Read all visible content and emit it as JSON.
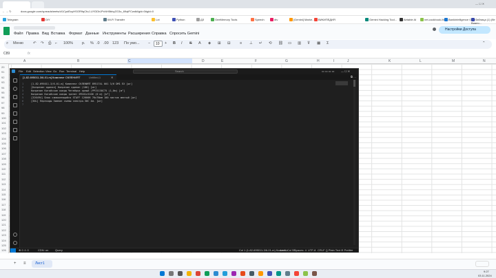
{
  "browser": {
    "url": "docs.google.com/spreadsheets/d/1CpdEuyHSGR9qCfuJ-UYDDhJPcNH5bbyZG3o_69qtFCwdkl/gid=0#gid=0",
    "bookmarks": [
      "Telegram",
      "",
      "",
      "DIY",
      "",
      "",
      "",
      "Wi-Fi Transfer",
      "",
      "Lot",
      "Python",
      "",
      "ДЗ",
      "GeeMemory Tools",
      "",
      "Speech",
      "",
      "dtv",
      "",
      "[Gemini] Marke...",
      "ВИКИПЕДИЯ",
      "",
      "",
      "Gemini Hacking Tool...",
      "",
      "Airtable AI",
      "",
      "net-cookbook-Mod...",
      "Bankintelligence Offer...",
      "Таблица (1) (бе Видео..."
    ]
  },
  "sheets": {
    "menu": [
      "Файл",
      "Правка",
      "Вид",
      "Вставка",
      "Формат",
      "Данные",
      "Инструменты",
      "Расширения",
      "Справка",
      "Спросить Gemini"
    ],
    "share_label": "Настройки Доступа",
    "search_label": "Меню",
    "zoom": "100%",
    "currency": "р.",
    "percent": "%",
    "decimals_dec": ".0",
    "decimals_inc": ".00",
    "number_format": "123",
    "font": "По умо...",
    "font_size": "10",
    "cell_ref": "C89",
    "fx": "fx",
    "columns": [
      "A",
      "B",
      "C",
      "D",
      "E",
      "F",
      "G",
      "H",
      "I",
      "J",
      "K",
      "L",
      "M",
      "N"
    ],
    "rows": [
      "20",
      "91",
      "92",
      "93",
      "94",
      "95",
      "96",
      "97",
      "98",
      "99",
      "100",
      "101",
      "102",
      "103",
      "104",
      "105",
      "106",
      "107",
      "108",
      "109",
      "110",
      "111",
      "112",
      "113",
      "114",
      "115",
      "116",
      "117",
      "118",
      "119",
      "120",
      "121",
      "122",
      "123",
      "124",
      "125",
      "126"
    ],
    "sheet_tab": "Лист1"
  },
  "vscode": {
    "menu": [
      "File",
      "Edit",
      "Selection",
      "View",
      "Go",
      "Run",
      "Terminal",
      "Help"
    ],
    "search": "Search",
    "tab_label": "[1-82-695011-3/6-01-m] Комплект СКЛЕНИЯТ",
    "tab_sub": "Untitled-1",
    "code_lines": [
      "[1-82-695011-3/6-01-m] Комплект СКЛЕНИЯТ 895174L 001 3/6 DM1 EX [шт]",
      "[Копрезин одинал] Копрезин одинал (100) [мт]",
      "Копрезин Китайские ковры Четвёрка ярный (PPI5138C75 (1,8м) [м²]",
      "Копрезин Китайские ковры тренет 2М101с5106 (0 м) [м²]",
      "[326494] Блок самоклеящийся STAFF 126006 76x76мм 100 листов желтый [шт]",
      "[30L] Переходы Зимние съемы электро.30С 4м. [шт]"
    ],
    "line_numbers": [
      "1",
      "2",
      "3",
      "4",
      "5",
      "6",
      "7"
    ],
    "status_left": "⊗ 0 ⚠ 0",
    "status_ai": "CDN: on",
    "status_query": "Query",
    "status_right": [
      "Col 1 (1-82-695011-3/6-01-m) Коммент...",
      "Ln 6, Col 55",
      "Spaces: 4",
      "UTF-8",
      "CRLF",
      "{} Plain Text",
      "⊘ Prettier"
    ]
  },
  "taskbar": {
    "time": "9:27",
    "date": "03.11.2024"
  }
}
